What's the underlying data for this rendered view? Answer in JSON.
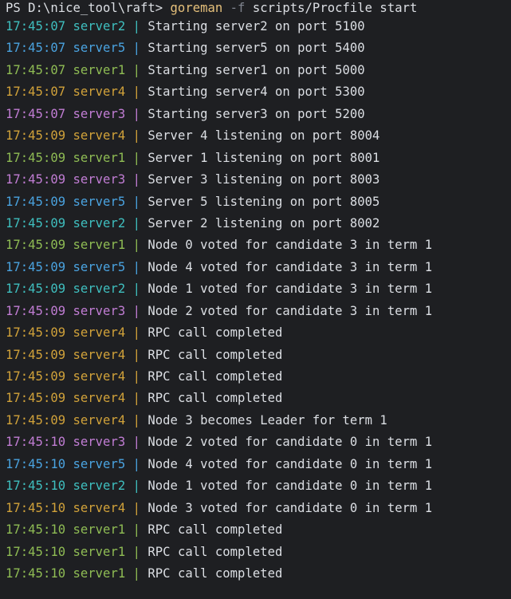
{
  "prompt": {
    "ps": "PS D:\\nice_tool\\raft>",
    "command": "goreman",
    "flag": "-f",
    "args": "scripts/Procfile start"
  },
  "colors": {
    "server1": "#8fbc54",
    "server2": "#3fbfbf",
    "server3": "#c17dd4",
    "server4": "#d1a23a",
    "server5": "#4aa3e0",
    "text": "#dcdfe4",
    "background": "#1e1f22"
  },
  "lines": [
    {
      "ts": "17:45:07",
      "srv": "server2",
      "msg": "Starting server2 on port 5100"
    },
    {
      "ts": "17:45:07",
      "srv": "server5",
      "msg": "Starting server5 on port 5400"
    },
    {
      "ts": "17:45:07",
      "srv": "server1",
      "msg": "Starting server1 on port 5000"
    },
    {
      "ts": "17:45:07",
      "srv": "server4",
      "msg": "Starting server4 on port 5300"
    },
    {
      "ts": "17:45:07",
      "srv": "server3",
      "msg": "Starting server3 on port 5200"
    },
    {
      "ts": "17:45:09",
      "srv": "server4",
      "msg": "Server 4 listening on port 8004"
    },
    {
      "ts": "17:45:09",
      "srv": "server1",
      "msg": "Server 1 listening on port 8001"
    },
    {
      "ts": "17:45:09",
      "srv": "server3",
      "msg": "Server 3 listening on port 8003"
    },
    {
      "ts": "17:45:09",
      "srv": "server5",
      "msg": "Server 5 listening on port 8005"
    },
    {
      "ts": "17:45:09",
      "srv": "server2",
      "msg": "Server 2 listening on port 8002"
    },
    {
      "ts": "17:45:09",
      "srv": "server1",
      "msg": "Node 0 voted for candidate 3 in term 1"
    },
    {
      "ts": "17:45:09",
      "srv": "server5",
      "msg": "Node 4 voted for candidate 3 in term 1"
    },
    {
      "ts": "17:45:09",
      "srv": "server2",
      "msg": "Node 1 voted for candidate 3 in term 1"
    },
    {
      "ts": "17:45:09",
      "srv": "server3",
      "msg": "Node 2 voted for candidate 3 in term 1"
    },
    {
      "ts": "17:45:09",
      "srv": "server4",
      "msg": "RPC call completed"
    },
    {
      "ts": "17:45:09",
      "srv": "server4",
      "msg": "RPC call completed"
    },
    {
      "ts": "17:45:09",
      "srv": "server4",
      "msg": "RPC call completed"
    },
    {
      "ts": "17:45:09",
      "srv": "server4",
      "msg": "RPC call completed"
    },
    {
      "ts": "17:45:09",
      "srv": "server4",
      "msg": "Node 3 becomes Leader for term 1"
    },
    {
      "ts": "17:45:10",
      "srv": "server3",
      "msg": "Node 2 voted for candidate 0 in term 1"
    },
    {
      "ts": "17:45:10",
      "srv": "server5",
      "msg": "Node 4 voted for candidate 0 in term 1"
    },
    {
      "ts": "17:45:10",
      "srv": "server2",
      "msg": "Node 1 voted for candidate 0 in term 1"
    },
    {
      "ts": "17:45:10",
      "srv": "server4",
      "msg": "Node 3 voted for candidate 0 in term 1"
    },
    {
      "ts": "17:45:10",
      "srv": "server1",
      "msg": "RPC call completed"
    },
    {
      "ts": "17:45:10",
      "srv": "server1",
      "msg": "RPC call completed"
    },
    {
      "ts": "17:45:10",
      "srv": "server1",
      "msg": "RPC call completed"
    }
  ]
}
